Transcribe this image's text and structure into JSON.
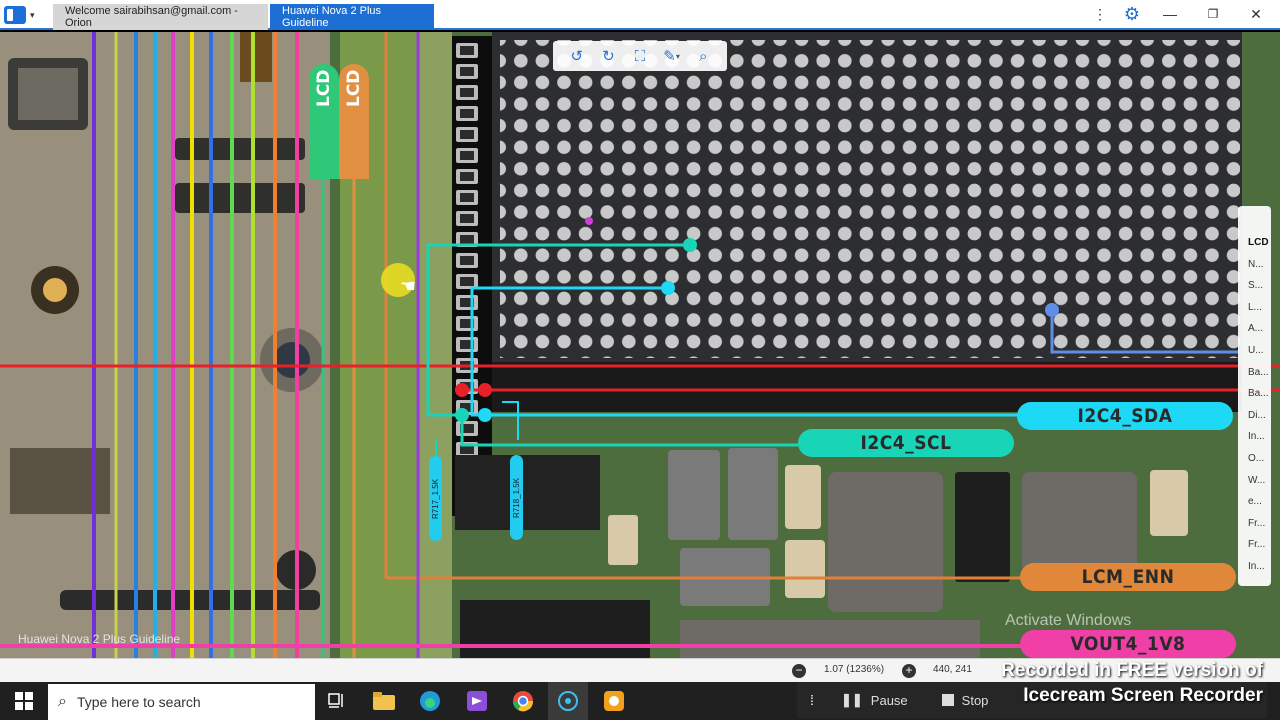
{
  "titlebar": {
    "tabs": [
      {
        "label": "Welcome sairabihsan@gmail.com - Orion"
      },
      {
        "label": "Huawei Nova 2 Plus Guideline"
      }
    ],
    "menu_icon": "kebab-icon",
    "settings_icon": "gear-icon",
    "minimize_icon": "minimize-icon",
    "maximize_icon": "maximize-icon",
    "close_icon": "close-icon"
  },
  "viewer": {
    "lcd_tags": [
      "LCD",
      "LCD"
    ],
    "component_labels": [
      "R717_1.5K",
      "R718_1.5K"
    ],
    "nets": [
      {
        "label": "I2C4_SDA",
        "color": "#1ed9f5"
      },
      {
        "label": "I2C4_SCL",
        "color": "#19d5b8"
      },
      {
        "label": "LCM_ENN",
        "color": "#e0873a"
      },
      {
        "label": "VOUT4_1V8",
        "color": "#f040a8"
      }
    ],
    "watermark": "Huawei Nova 2 Plus Guideline",
    "activate_windows": "Activate Windows"
  },
  "floating_toolbar": {
    "buttons": [
      "rotate-left-icon",
      "rotate-right-icon",
      "fit-screen-icon",
      "draw-icon",
      "zoom-icon"
    ]
  },
  "side_panel": {
    "items": [
      "LCD",
      "N...",
      "S...",
      "L...",
      "A...",
      "U...",
      "Ba...",
      "Ba...",
      "Di...",
      "In...",
      "O...",
      "W...",
      "e...",
      "Fr...",
      "Fr...",
      "In..."
    ]
  },
  "statusbar": {
    "zoom": "1.07 (1236%)",
    "coords": "440, 241"
  },
  "recorder": {
    "watermark_line1": "Recorded in FREE version of",
    "watermark_line2": "Icecream Screen Recorder",
    "pause_label": "Pause",
    "stop_label": "Stop"
  },
  "taskbar": {
    "search_placeholder": "Type here to search",
    "apps": [
      "task-view-icon",
      "file-explorer-icon",
      "edge-icon",
      "visual-studio-icon",
      "chrome-icon",
      "app-icon",
      "recorder-icon"
    ]
  },
  "colors": {
    "accent": "#1e6fd3",
    "board": "#4d6a3e",
    "red_line": "#e8202a",
    "cyan": "#1ed9f5",
    "teal": "#19d5b8",
    "orange": "#e0873a",
    "pink": "#f040a8"
  }
}
